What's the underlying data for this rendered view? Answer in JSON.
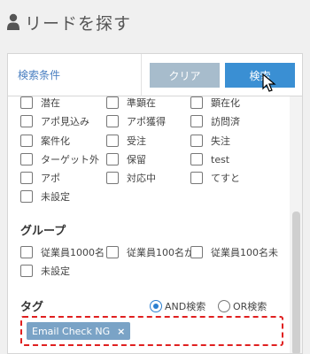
{
  "header": {
    "title": "リードを探す",
    "icon": "person-icon"
  },
  "panel": {
    "label": "検索条件",
    "clear_button": "クリア",
    "search_button": "検索"
  },
  "status_options": [
    [
      "潜在",
      "準顕在",
      "顕在化"
    ],
    [
      "アポ見込み",
      "アポ獲得",
      "訪問済"
    ],
    [
      "案件化",
      "受注",
      "失注"
    ],
    [
      "ターゲット外",
      "保留",
      "test"
    ],
    [
      "アポ",
      "対応中",
      "てすと"
    ],
    [
      "未設定"
    ]
  ],
  "group": {
    "title": "グループ",
    "options": [
      "従業員1000名",
      "従業員100名か",
      "従業員100名未"
    ],
    "unset": "未設定"
  },
  "tag": {
    "title": "タグ",
    "and_label": "AND検索",
    "or_label": "OR検索",
    "selected_mode": "AND",
    "chip_label": "Email Check NG",
    "chip_remove": "×"
  },
  "colors": {
    "accent": "#3a8fd3",
    "clear": "#a7bccc",
    "tag_chip": "#7aa3c6",
    "highlight_border": "#e02020"
  }
}
